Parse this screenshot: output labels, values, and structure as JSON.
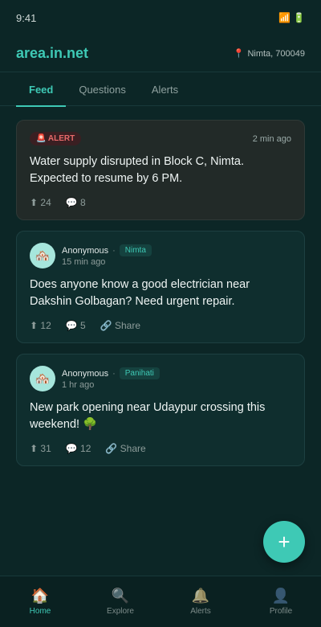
{
  "status_bar": {
    "time": "9:41",
    "signal_icon": "📶",
    "battery_icon": "🔋"
  },
  "header": {
    "brand": "area.in.net",
    "location_icon": "📍",
    "location": "Nimta, 700049"
  },
  "tabs": [
    {
      "label": "Feed",
      "active": true
    },
    {
      "label": "Questions",
      "active": false
    },
    {
      "label": "Alerts",
      "active": false
    }
  ],
  "feed": {
    "alert": {
      "badge": "🚨 ALERT",
      "time": "2 min ago",
      "text": "Water supply disrupted in Block C, Nimta. Expected to resume by 6 PM.",
      "upvotes": "⬆ 24",
      "comments": "💬 8"
    },
    "posts": [
      {
        "avatar": "🏘️",
        "author": "Anonymous",
        "separator": "·",
        "tag": "Nimta",
        "time": "15 min ago",
        "text": "Does anyone know a good electrician near Dakshin Golbagan? Need urgent repair.",
        "upvotes": "⬆ 12",
        "comments": "💬 5",
        "share": "🔗 Share"
      },
      {
        "avatar": "🏘️",
        "author": "Anonymous",
        "separator": "·",
        "tag": "Panihati",
        "time": "1 hr ago",
        "text": "New park opening near Udaypur crossing this weekend! 🌳",
        "upvotes": "⬆ 31",
        "comments": "💬 12",
        "share": "🔗 Share"
      }
    ]
  },
  "fab": {
    "label": "+"
  },
  "bottom_nav": [
    {
      "icon": "🏠",
      "label": "Home",
      "active": true
    },
    {
      "icon": "🔍",
      "label": "Explore",
      "active": false
    },
    {
      "icon": "🔔",
      "label": "Alerts",
      "active": false
    },
    {
      "icon": "👤",
      "label": "Profile",
      "active": false
    }
  ],
  "colors": {
    "accent": "#3ec9b5",
    "background": "#0c2626",
    "alert": "#e86a6a"
  }
}
